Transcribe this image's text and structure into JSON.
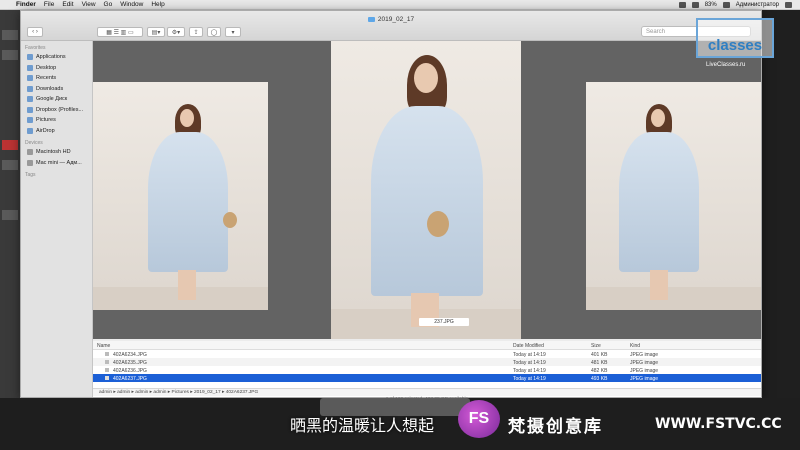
{
  "menubar": {
    "items": [
      "Finder",
      "File",
      "Edit",
      "View",
      "Go",
      "Window",
      "Help"
    ],
    "battery": "83%",
    "user": "Администратор"
  },
  "window": {
    "title": "2019_02_17",
    "search_placeholder": "Search"
  },
  "sidebar": {
    "favorites_heading": "Favorites",
    "favorites": [
      "Applications",
      "Desktop",
      "Recents",
      "Downloads",
      "Google Диск",
      "Dropbox (Profiles...",
      "Pictures",
      "AirDrop"
    ],
    "devices_heading": "Devices",
    "devices": [
      "Macintosh HD",
      "Mac mini — Адм..."
    ],
    "tags_heading": "Tags"
  },
  "quicklook": {
    "selected_label": "237.JPG"
  },
  "list": {
    "columns": {
      "name": "Name",
      "date": "Date Modified",
      "size": "Size",
      "kind": "Kind"
    },
    "rows": [
      {
        "name": "402A6234.JPG",
        "date": "Today at 14:19",
        "size": "401 KB",
        "kind": "JPEG image"
      },
      {
        "name": "402A6235.JPG",
        "date": "Today at 14:19",
        "size": "481 KB",
        "kind": "JPEG image"
      },
      {
        "name": "402A6236.JPG",
        "date": "Today at 14:19",
        "size": "482 KB",
        "kind": "JPEG image"
      },
      {
        "name": "402A6237.JPG",
        "date": "Today at 14:19",
        "size": "493 KB",
        "kind": "JPEG image"
      }
    ]
  },
  "pathbar": "admin ▸ admin ▸ admin ▸ admin ▸ Pictures ▸ 2019_02_17 ▸ 402A6237.JPG",
  "status": "1 of 120 selected, 423,09 GB available",
  "watermark": {
    "logo": "classes",
    "url": "LiveClasses.ru"
  },
  "overlay": {
    "subtitle": "晒黑的温暖让人想起",
    "badge": "FS",
    "brand": "梵摄创意库",
    "brand_url": "WWW.FSTVC.CC"
  }
}
